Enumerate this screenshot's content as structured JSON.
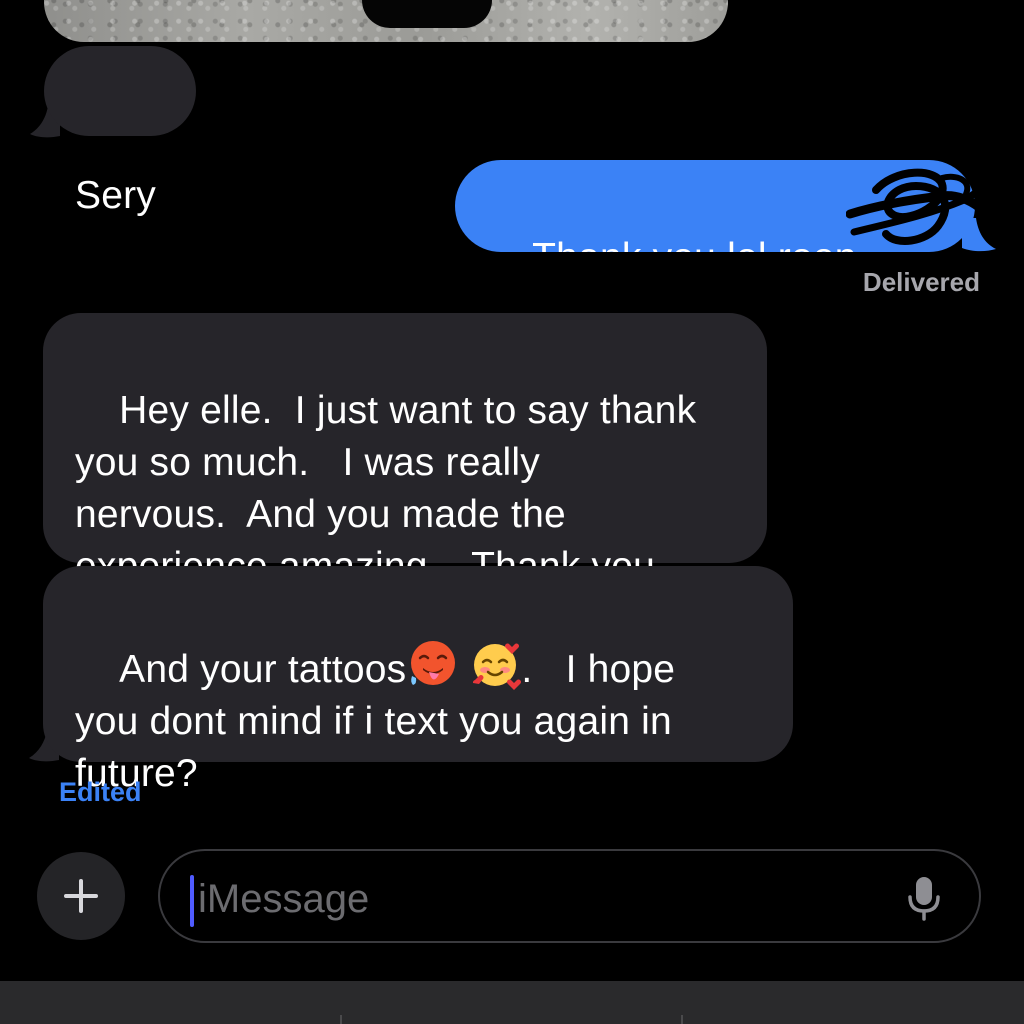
{
  "messages": {
    "sery": "Sery",
    "thanks": "Thank you lol roon",
    "delivered": "Delivered",
    "hey": "Hey elle.  I just want to say thank\nyou so much.   I was really\nnervous.  And you made the\nexperience amazing.   Thank you",
    "tattoos_a": "And your tattoos",
    "tattoos_b": ".   I hope\nyou dont mind if i text you again in\nfuture?",
    "edited": "Edited"
  },
  "input": {
    "placeholder": "iMessage"
  },
  "icons": {
    "plus": "plus-icon",
    "mic": "microphone-icon",
    "emoji_1": "hot-face-emoji",
    "emoji_2": "smiling-face-with-hearts-emoji"
  },
  "colors": {
    "incoming_bubble": "#26252a",
    "outgoing_bubble": "#3b82f6",
    "edited_label": "#3b82f6",
    "background": "#000000"
  }
}
